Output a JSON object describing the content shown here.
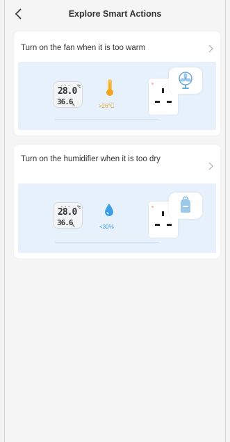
{
  "header": {
    "back_icon": "chevron-left-icon",
    "title": "Explore Smart Actions"
  },
  "cards": [
    {
      "title": "Turn on the fan when it is too warm",
      "chevron_icon": "chevron-right-icon",
      "sensor": {
        "temperature": "28.0",
        "temp_unit": "°c",
        "humidity": "36.6",
        "humidity_unit": "%"
      },
      "condition": {
        "icon": "thermometer-icon",
        "label": ">26°C",
        "color": "#e2a018"
      },
      "plug_icon": "smart-plug-icon",
      "target_icon": "fan-icon"
    },
    {
      "title": "Turn on the humidifier when it is too dry",
      "chevron_icon": "chevron-right-icon",
      "sensor": {
        "temperature": "28.0",
        "temp_unit": "°c",
        "humidity": "36.6",
        "humidity_unit": "%"
      },
      "condition": {
        "icon": "water-drop-icon",
        "label": "<30%",
        "color": "#3c9ee5"
      },
      "plug_icon": "smart-plug-icon",
      "target_icon": "humidifier-icon"
    }
  ],
  "colors": {
    "background": "#f5f5f5",
    "card": "#ffffff",
    "illustration_bg": "#e6f1fb",
    "warm_accent": "#e2a018",
    "dry_accent": "#3c9ee5"
  }
}
